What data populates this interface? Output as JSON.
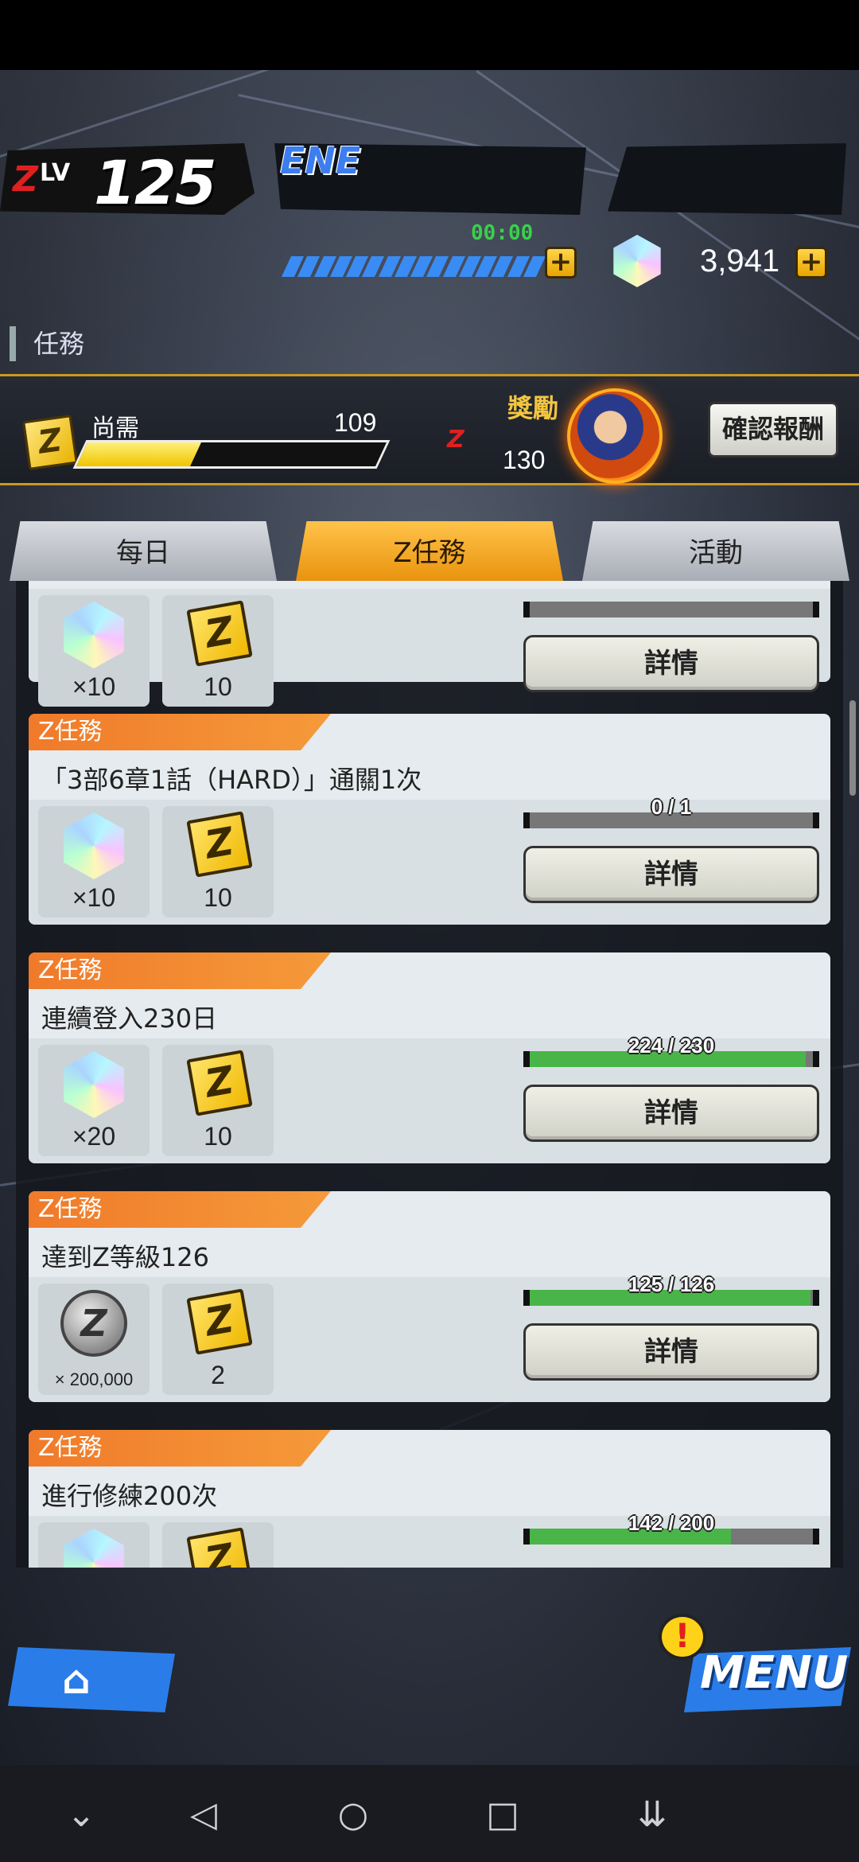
{
  "header": {
    "z_level": "125",
    "z_label": "Z",
    "lv_label": "LV",
    "energy_label": "ENE",
    "energy_timer": "00:00",
    "gems": "3,941",
    "plus": "+"
  },
  "section_title": "任務",
  "banner": {
    "need_label": "尚需",
    "need_value": "109",
    "need_progress_fraction": 0.38,
    "reward_label": "獎勵",
    "reward_level": "130",
    "confirm_label": "確認報酬"
  },
  "tabs": [
    {
      "label": "每日",
      "active": false
    },
    {
      "label": "Z任務",
      "active": true
    },
    {
      "label": "活動",
      "active": false
    }
  ],
  "missions": [
    {
      "tag": "",
      "title": "",
      "reward1_icon": "crystal-icon",
      "reward1_qty": "×10",
      "reward2_icon": "z-medal-icon",
      "reward2_qty": "10",
      "progress_text": "",
      "progress_fraction": 0,
      "detail_label": "詳情"
    },
    {
      "tag": "Z任務",
      "title": "「3部6章1話（HARD）」通關1次",
      "reward1_icon": "crystal-icon",
      "reward1_qty": "×10",
      "reward2_icon": "z-medal-icon",
      "reward2_qty": "10",
      "progress_text": "0 / 1",
      "progress_fraction": 0,
      "detail_label": "詳情"
    },
    {
      "tag": "Z任務",
      "title": "連續登入230日",
      "reward1_icon": "crystal-icon",
      "reward1_qty": "×20",
      "reward2_icon": "z-medal-icon",
      "reward2_qty": "10",
      "progress_text": "224 / 230",
      "progress_fraction": 0.974,
      "detail_label": "詳情"
    },
    {
      "tag": "Z任務",
      "title": "達到Z等級126",
      "reward1_icon": "zeni-coin-icon",
      "reward1_qty": "× 200,000",
      "reward2_icon": "z-medal-icon",
      "reward2_qty": "2",
      "progress_text": "125 / 126",
      "progress_fraction": 0.992,
      "detail_label": "詳情"
    },
    {
      "tag": "Z任務",
      "title": "進行修練200次",
      "reward1_icon": "crystal-icon",
      "reward1_qty": "",
      "reward2_icon": "z-medal-icon",
      "reward2_qty": "",
      "progress_text": "142 / 200",
      "progress_fraction": 0.71,
      "detail_label": ""
    }
  ],
  "bottom": {
    "menu_label": "MENU",
    "alert": "!",
    "home_icon": "home-icon"
  },
  "system_nav": [
    "chevron-down-icon",
    "back-icon",
    "home-circle-icon",
    "recents-icon",
    "notification-pull-icon"
  ]
}
